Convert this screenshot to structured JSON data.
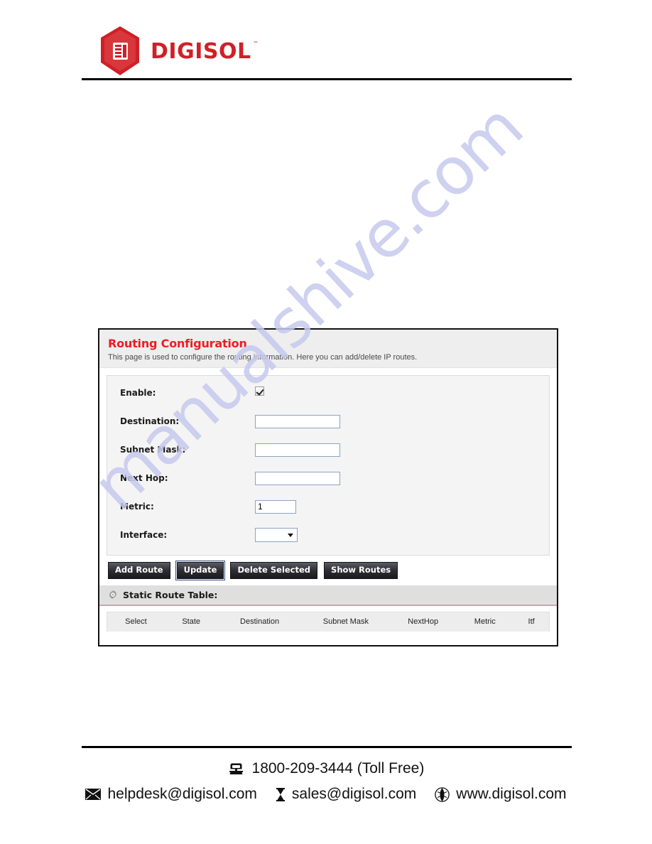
{
  "header": {
    "logo_text": "DIGISOL",
    "logo_tm": "™",
    "logo_color": "#cf2027",
    "logo_icon": "digisol-hexagon-logo"
  },
  "panel": {
    "title": "Routing Configuration",
    "title_color": "#ee1c25",
    "description": "This page is used to configure the routing information. Here you can add/delete IP routes.",
    "form": {
      "rows": [
        {
          "label": "Enable:",
          "type": "checkbox",
          "checked": true,
          "value": ""
        },
        {
          "label": "Destination:",
          "type": "text",
          "value": "",
          "placeholder": ""
        },
        {
          "label": "Subnet Mask:",
          "type": "text",
          "value": "",
          "placeholder": ""
        },
        {
          "label": "Next Hop:",
          "type": "text",
          "value": "",
          "placeholder": ""
        },
        {
          "label": "Metric:",
          "type": "text",
          "value": "1",
          "placeholder": ""
        },
        {
          "label": "Interface:",
          "type": "select",
          "value": "",
          "options": [
            ""
          ]
        }
      ]
    },
    "buttons": [
      {
        "label": "Add Route",
        "focused": false
      },
      {
        "label": "Update",
        "focused": true
      },
      {
        "label": "Delete Selected",
        "focused": false
      },
      {
        "label": "Show Routes",
        "focused": false
      }
    ],
    "table_section": {
      "icon": "gear-icon",
      "title": "Static Route Table:",
      "columns": [
        "Select",
        "State",
        "Destination",
        "Subnet Mask",
        "NextHop",
        "Metric",
        "Itf"
      ],
      "rows": []
    }
  },
  "watermark": {
    "text": "manualshive.com",
    "color": "#c7c9ee"
  },
  "footer": {
    "phone_icon": "telephone-icon",
    "phone": "1800-209-3444 (Toll Free)",
    "contacts": [
      {
        "icon": "envelope-icon",
        "text": "helpdesk@digisol.com"
      },
      {
        "icon": "hourglass-icon",
        "text": "sales@digisol.com"
      },
      {
        "icon": "globe-icon",
        "text": "www.digisol.com"
      }
    ]
  }
}
